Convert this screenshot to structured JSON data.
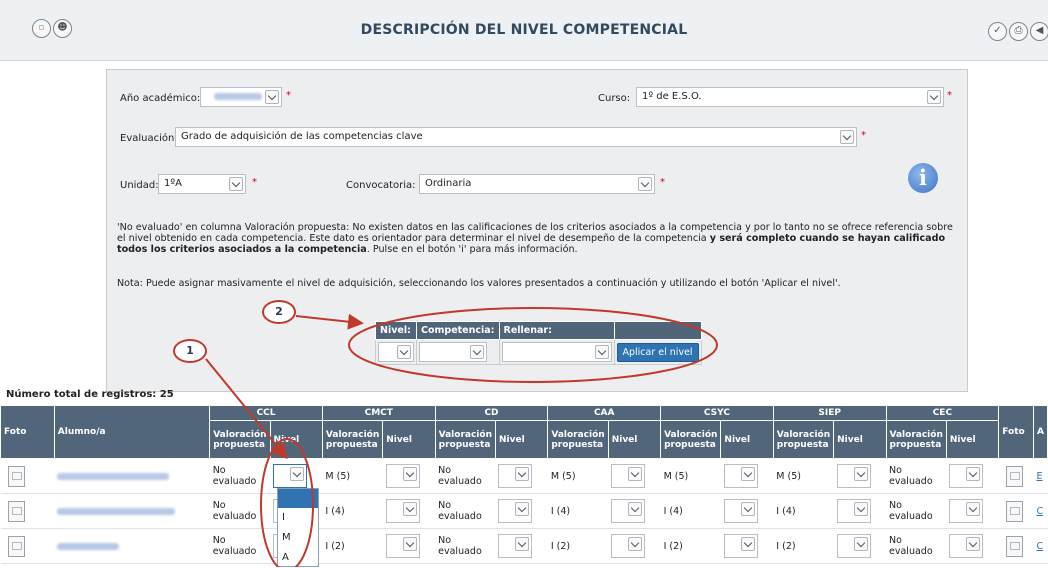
{
  "header": {
    "title": "DESCRIPCIÓN DEL NIVEL COMPETENCIAL"
  },
  "form": {
    "anio_label": "Año académico:",
    "curso_label": "Curso:",
    "curso_value": "1º de E.S.O.",
    "evaluacion_label": "Evaluación:",
    "evaluacion_value": "Grado de adquisición de las competencias clave",
    "unidad_label": "Unidad:",
    "unidad_value": "1ºA",
    "convocatoria_label": "Convocatoria:",
    "convocatoria_value": "Ordinaria",
    "required_mark": "*",
    "info_glyph": "i",
    "note1_a": "'No evaluado' en columna Valoración propuesta:  No existen datos en las calificaciones de los criterios asociados a la competencia y por lo tanto no se ofrece referencia sobre el nivel obtenido en cada competencia. Este dato es orientador para determinar el nivel de desempeño de la competencia ",
    "note1_b": "y será completo cuando se hayan calificado todos los criterios asociados a la competencia",
    "note1_c": ". Pulse en el botón 'i' para más información.",
    "note2": "Nota:  Puede asignar masivamente el nivel de adquisición, seleccionando los valores presentados a continuación y utilizando el botón 'Aplicar el nivel'.",
    "mass": {
      "nivel_label": "Nivel:",
      "competencia_label": "Competencia:",
      "rellenar_label": "Rellenar:",
      "apply_label": "Aplicar el nivel"
    }
  },
  "annotations": [
    "1",
    "2"
  ],
  "table": {
    "total_label": "Número total de registros: 25",
    "foto_header": "Foto",
    "alumno_header": "Alumno/a",
    "val_header": "Valoración propuesta",
    "nivel_header": "Nivel",
    "last_header": "A",
    "competencias": [
      "CCL",
      "CMCT",
      "CD",
      "CAA",
      "CSYC",
      "SIEP",
      "CEC"
    ],
    "rows": [
      {
        "vals": [
          "No evaluado",
          "M (5)",
          "No evaluado",
          "M (5)",
          "M (5)",
          "M (5)",
          "No evaluado"
        ],
        "link": "E"
      },
      {
        "vals": [
          "No evaluado",
          "I (4)",
          "No evaluado",
          "I (4)",
          "I (4)",
          "I (4)",
          "No evaluado"
        ],
        "link": "C"
      },
      {
        "vals": [
          "No evaluado",
          "I (2)",
          "No evaluado",
          "I (2)",
          "I (2)",
          "I (2)",
          "No evaluado"
        ],
        "link": "C"
      }
    ],
    "dropdown_options": [
      "I",
      "M",
      "A"
    ]
  },
  "colors": {
    "header_bg": "#52667b",
    "button_bg": "#2f73b3",
    "annotation": "#c0392b"
  }
}
